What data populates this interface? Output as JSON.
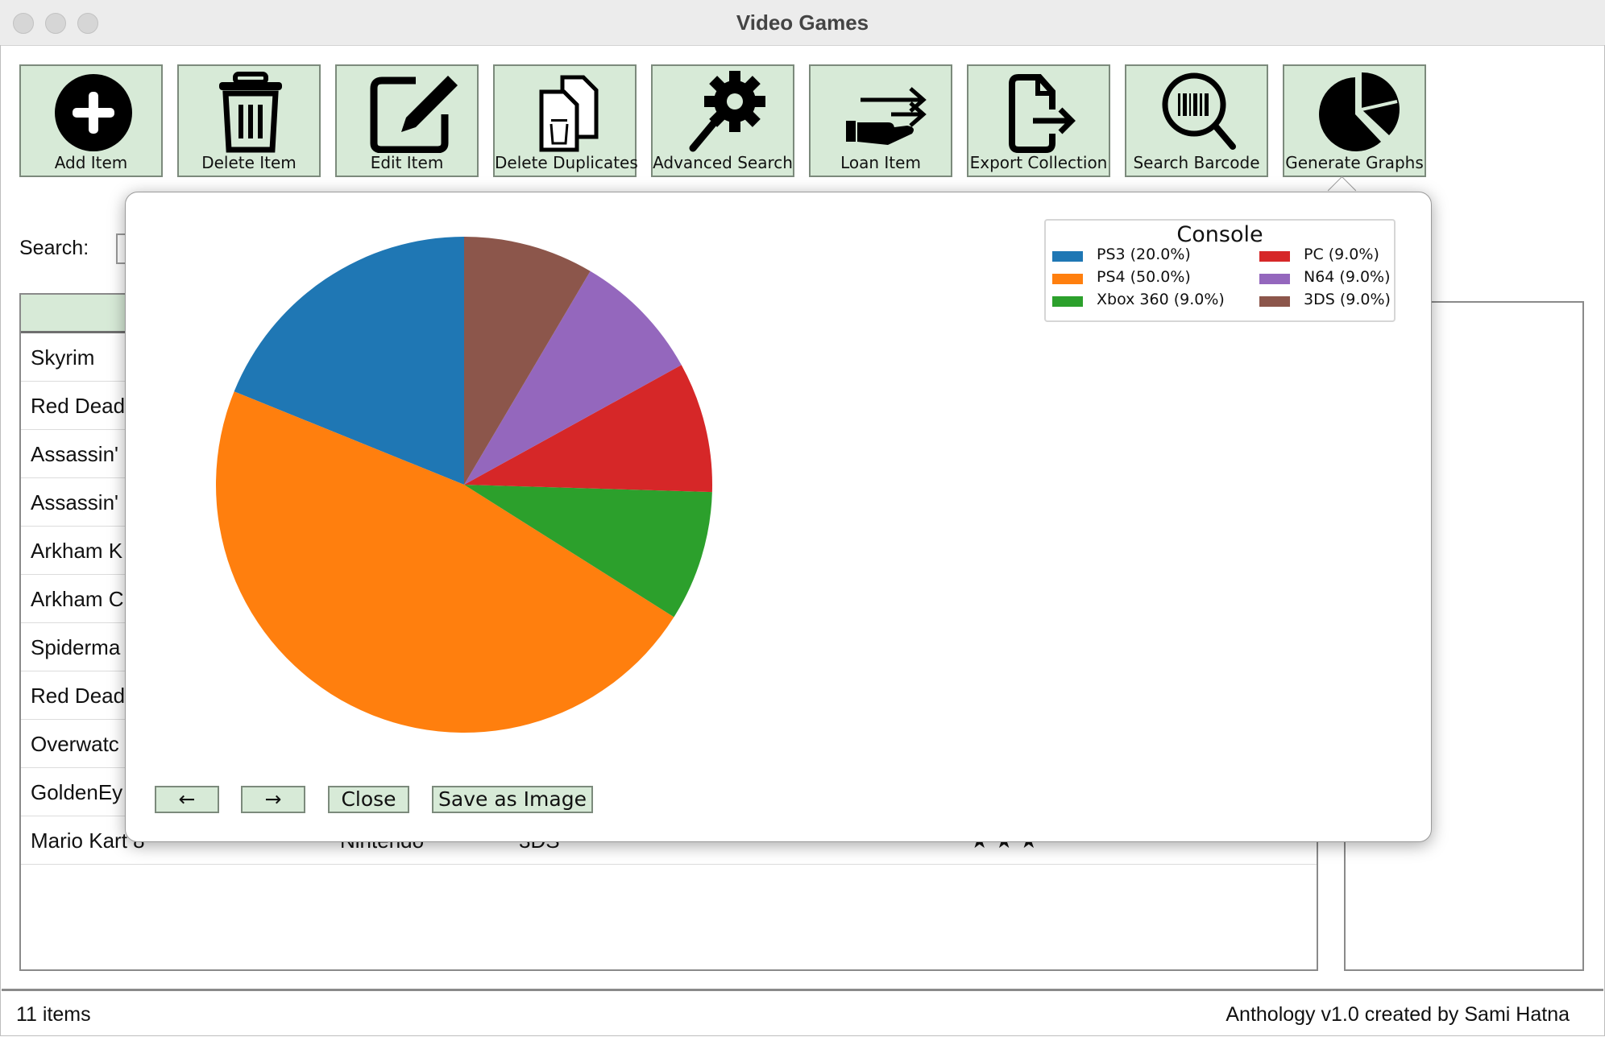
{
  "window": {
    "title": "Video Games"
  },
  "toolbar": [
    {
      "label": "Add Item",
      "icon": "plus-circle-icon"
    },
    {
      "label": "Delete Item",
      "icon": "trash-icon"
    },
    {
      "label": "Edit Item",
      "icon": "edit-icon"
    },
    {
      "label": "Delete Duplicates",
      "icon": "duplicate-delete-icon"
    },
    {
      "label": "Advanced Search",
      "icon": "gear-search-icon"
    },
    {
      "label": "Loan Item",
      "icon": "hand-arrow-icon"
    },
    {
      "label": "Export Collection",
      "icon": "export-file-icon"
    },
    {
      "label": "Search Barcode",
      "icon": "barcode-search-icon"
    },
    {
      "label": "Generate Graphs",
      "icon": "pie-chart-icon"
    }
  ],
  "search": {
    "label": "Search:"
  },
  "table": {
    "rows": [
      {
        "title": "Skyrim"
      },
      {
        "title": "Red Dead"
      },
      {
        "title": "Assassin'"
      },
      {
        "title": "Assassin'"
      },
      {
        "title": "Arkham K"
      },
      {
        "title": "Arkham C"
      },
      {
        "title": "Spiderma"
      },
      {
        "title": "Red Dead"
      },
      {
        "title": "Overwatc"
      },
      {
        "title": "GoldenEy"
      },
      {
        "title": "Mario Kart 8",
        "publisher": "Nintendo",
        "console": "3DS",
        "rating": "★ ★ ★"
      }
    ]
  },
  "status": {
    "count": "11 items",
    "credit": "Anthology v1.0 created by Sami Hatna"
  },
  "chart_data": {
    "type": "pie",
    "legend_title": "Console",
    "legend_placement": "top-right",
    "slices": [
      {
        "label": "PS3 (20.0%)",
        "value": 20.0,
        "color": "#1f77b4"
      },
      {
        "label": "PS4 (50.0%)",
        "value": 50.0,
        "color": "#ff7f0e"
      },
      {
        "label": "Xbox 360 (9.0%)",
        "value": 9.0,
        "color": "#2ca02c"
      },
      {
        "label": "PC (9.0%)",
        "value": 9.0,
        "color": "#d62728"
      },
      {
        "label": "N64 (9.0%)",
        "value": 9.0,
        "color": "#9467bd"
      },
      {
        "label": "3DS (9.0%)",
        "value": 9.0,
        "color": "#8c564b"
      }
    ]
  },
  "popover": {
    "back_label": "←",
    "forward_label": "→",
    "close_label": "Close",
    "save_label": "Save as Image"
  }
}
